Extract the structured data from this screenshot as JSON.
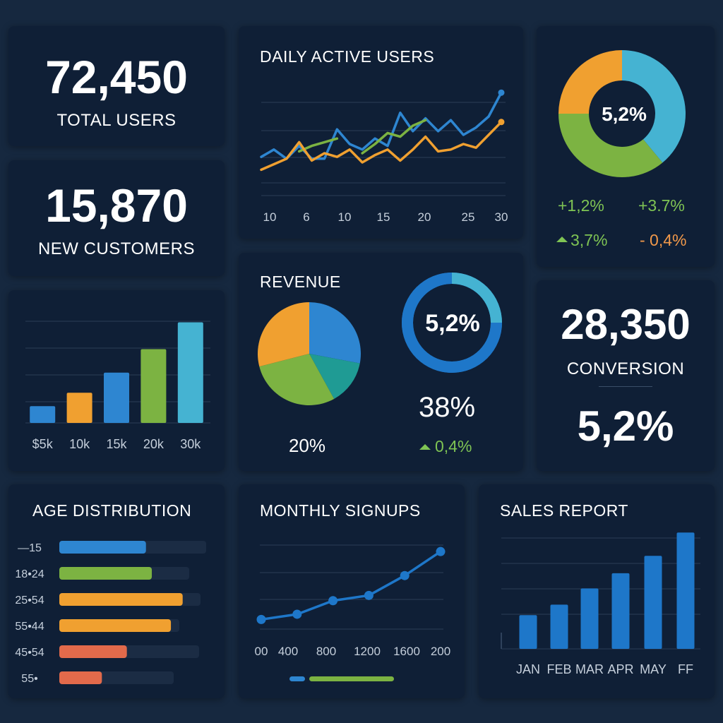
{
  "colors": {
    "background": "#16283f",
    "card": "#0f1f36",
    "blue": "#2e86d1",
    "cyan": "#45b3d2",
    "green": "#7cb342",
    "orange": "#f0a030",
    "teal": "#1f9b94",
    "red": "#e26a4b",
    "positive": "#7fc454",
    "negative": "#f2994a"
  },
  "total_users": {
    "value": "72,450",
    "label": "TOTAL USERS"
  },
  "new_customers": {
    "value": "15,870",
    "label": "NEW CUSTOMERS"
  },
  "conversion": {
    "value": "28,350",
    "label": "CONVERSION",
    "rate": "5,2%"
  },
  "top_donut": {
    "center_label": "5,2%",
    "stats": [
      {
        "text": "+1,2%",
        "tone": "positive"
      },
      {
        "text": "+3.7%",
        "tone": "positive"
      },
      {
        "text": "3,7%",
        "tone": "positive",
        "icon": "triangle-up-icon"
      },
      {
        "text": "- 0,4%",
        "tone": "negative"
      }
    ]
  },
  "revenue": {
    "title": "REVENUE",
    "pie_label": "20%",
    "ring_label": "5,2%",
    "ring_value": "38%",
    "change": "0,4%"
  },
  "chart_data": [
    {
      "id": "daily-active-users",
      "type": "line",
      "title": "DAILY ACTIVE USERS",
      "x_tick_labels": [
        "10",
        "6",
        "10",
        "15",
        "20",
        "25",
        "30"
      ],
      "x": [
        1,
        2,
        3,
        4,
        5,
        6,
        7,
        8,
        9,
        10,
        11,
        12,
        13,
        14,
        15,
        16,
        17,
        18,
        19,
        20
      ],
      "ylim": [
        0,
        100
      ],
      "grid": true,
      "series": [
        {
          "color": "#2e86d1",
          "values": [
            36,
            44,
            34,
            48,
            34,
            34,
            66,
            50,
            44,
            56,
            48,
            84,
            64,
            78,
            64,
            76,
            60,
            68,
            80,
            106
          ]
        },
        {
          "color": "#7cb342",
          "values": [
            null,
            null,
            null,
            42,
            48,
            52,
            56,
            null,
            40,
            50,
            62,
            58,
            70,
            76,
            null,
            null,
            null,
            null,
            null,
            null
          ]
        },
        {
          "color": "#f0a030",
          "values": [
            22,
            28,
            34,
            52,
            32,
            40,
            36,
            44,
            30,
            38,
            44,
            32,
            44,
            58,
            42,
            44,
            50,
            46,
            60,
            74
          ]
        }
      ]
    },
    {
      "id": "top-donut",
      "type": "pie",
      "donut": true,
      "slices": [
        {
          "value": 39,
          "color": "#45b3d2"
        },
        {
          "value": 36,
          "color": "#7cb342"
        },
        {
          "value": 25,
          "color": "#f0a030"
        }
      ]
    },
    {
      "id": "bar-amounts",
      "type": "bar",
      "categories": [
        "$5k",
        "10k",
        "15k",
        "20k",
        "30k"
      ],
      "values": [
        5,
        9,
        15,
        22,
        30
      ],
      "colors": [
        "#2e86d1",
        "#f0a030",
        "#2e86d1",
        "#7cb342",
        "#45b3d2"
      ],
      "ylim": [
        0,
        32
      ],
      "grid": true
    },
    {
      "id": "revenue-pie",
      "type": "pie",
      "slices": [
        {
          "value": 28,
          "color": "#2e86d1"
        },
        {
          "value": 14,
          "color": "#1f9b94"
        },
        {
          "value": 29,
          "color": "#7cb342"
        },
        {
          "value": 29,
          "color": "#f0a030"
        }
      ]
    },
    {
      "id": "revenue-ring",
      "type": "pie",
      "donut": true,
      "slices": [
        {
          "value": 25,
          "color": "#45b3d2"
        },
        {
          "value": 75,
          "color": "#1e77c9"
        }
      ]
    },
    {
      "id": "age-distribution",
      "type": "bar",
      "orientation": "horizontal",
      "title": "AGE DISTRIBUTION",
      "categories": [
        "—15",
        "18•24",
        "25•54",
        "55•44",
        "45•54",
        "55•"
      ],
      "values": [
        0.59,
        0.63,
        0.84,
        0.76,
        0.46,
        0.29
      ],
      "colors": [
        "#2e86d1",
        "#7cb342",
        "#f0a030",
        "#f0a030",
        "#e26a4b",
        "#e26a4b"
      ]
    },
    {
      "id": "monthly-signups",
      "type": "line",
      "title": "MONTHLY SIGNUPS",
      "x_tick_labels": [
        "00",
        "400",
        "800",
        "1200",
        "1600",
        "200"
      ],
      "x": [
        1,
        2,
        3,
        4,
        5,
        6
      ],
      "values": [
        18,
        23,
        36,
        41,
        60,
        83
      ],
      "ylim": [
        0,
        100
      ],
      "grid": true,
      "legend_colors": [
        "#2e86d1",
        "#7cb342"
      ]
    },
    {
      "id": "sales-report",
      "type": "bar",
      "title": "SALES REPORT",
      "categories": [
        "JAN",
        "FEB",
        "MAR",
        "APR",
        "MAY",
        "FF"
      ],
      "values": [
        29,
        38,
        52,
        65,
        80,
        100
      ],
      "color": "#1e77c9",
      "ylim": [
        0,
        105
      ],
      "grid": true
    }
  ]
}
